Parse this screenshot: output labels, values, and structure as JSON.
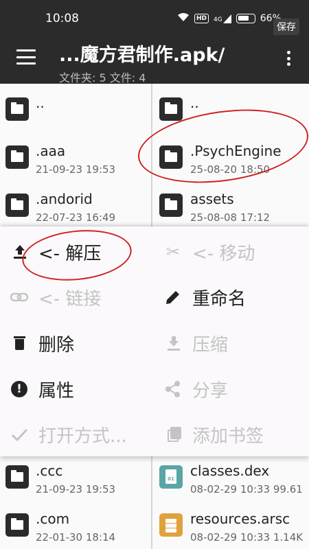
{
  "status_bar": {
    "time": "10:08",
    "hd_badge": "HD",
    "network": "4G",
    "battery": "66%",
    "save_chip": "保存"
  },
  "toolbar": {
    "title": "...魔方君制作.apk/",
    "subtitle": "文件夹: 5  文件: 4"
  },
  "left_pane": {
    "items": [
      {
        "name": "..",
        "meta": "",
        "type": "folder"
      },
      {
        "name": ".aaa",
        "meta": "21-09-23 19:53",
        "type": "folder"
      },
      {
        "name": ".andorid",
        "meta": "22-07-23 16:49",
        "type": "folder"
      },
      {
        "name": "",
        "meta": "",
        "type": "hidden"
      },
      {
        "name": "",
        "meta": "",
        "type": "hidden"
      },
      {
        "name": "",
        "meta": "",
        "type": "hidden"
      },
      {
        "name": "",
        "meta": "",
        "type": "hidden"
      },
      {
        "name": ".ccc",
        "meta": "21-09-23 19:53",
        "type": "folder"
      },
      {
        "name": ".com",
        "meta": "22-01-30 18:14",
        "type": "folder"
      }
    ]
  },
  "right_pane": {
    "items": [
      {
        "name": "..",
        "meta": "",
        "type": "folder"
      },
      {
        "name": ".PsychEngine",
        "meta": "25-08-20 18:50",
        "type": "folder"
      },
      {
        "name": "assets",
        "meta": "25-08-08 17:12",
        "type": "folder"
      },
      {
        "name": "classes.dex",
        "meta": "08-02-29 10:33 99.61",
        "type": "dex"
      },
      {
        "name": "resources.arsc",
        "meta": "08-02-29 10:33 1.14K",
        "type": "arsc"
      }
    ],
    "dex_icon_text": "01"
  },
  "context_menu": {
    "extract": "<- 解压",
    "move": "<- 移动",
    "link": "<- 链接",
    "rename": "重命名",
    "delete": "删除",
    "compress": "压缩",
    "properties": "属性",
    "share": "分享",
    "open_with": "打开方式...",
    "add_bookmark": "添加书签"
  },
  "colors": {
    "appbar": "#2b2b2b",
    "annotation": "#d02020",
    "disabled": "#c4c4c4",
    "dex_icon": "#5aa5a5",
    "arsc_icon": "#e0a23c"
  }
}
